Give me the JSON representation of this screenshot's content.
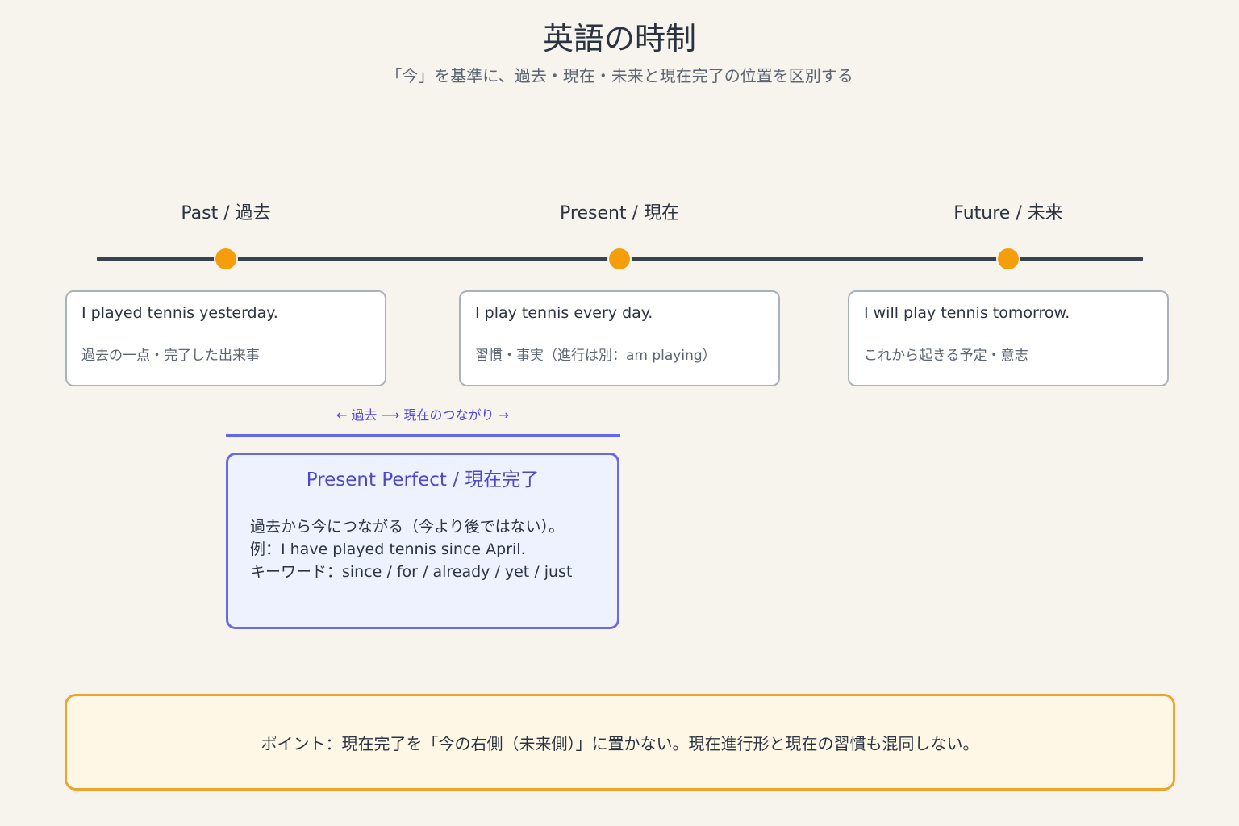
{
  "header": {
    "title": "英語の時制",
    "subtitle": "「今」を基準に、過去・現在・未来と現在完了の位置を区別する"
  },
  "timeline": {
    "labels": {
      "past": "Past / 過去",
      "present": "Present / 現在",
      "future": "Future / 未来"
    },
    "colors": {
      "line": "#384251",
      "dot": "#f59e0b"
    }
  },
  "cards": {
    "past": {
      "example": "I played tennis yesterday.",
      "note": "過去の一点・完了した出来事"
    },
    "present": {
      "example": "I play tennis every day.",
      "note": "習慣・事実（進行は別：am playing）"
    },
    "future": {
      "example": "I will play tennis tomorrow.",
      "note": "これから起きる予定・意志"
    }
  },
  "connection": {
    "label": "← 過去 ⟶ 現在のつながり →",
    "color": "#6366f1"
  },
  "present_perfect": {
    "title": "Present Perfect / 現在完了",
    "lines": [
      "過去から今につながる（今より後ではない）。",
      "例：I have played tennis since April.",
      "キーワード：since / for / already / yet / just"
    ]
  },
  "point": {
    "text": "ポイント：現在完了を「今の右側（未来側）」に置かない。現在進行形と現在の習慣も混同しない。",
    "color": "#f0a32a"
  }
}
